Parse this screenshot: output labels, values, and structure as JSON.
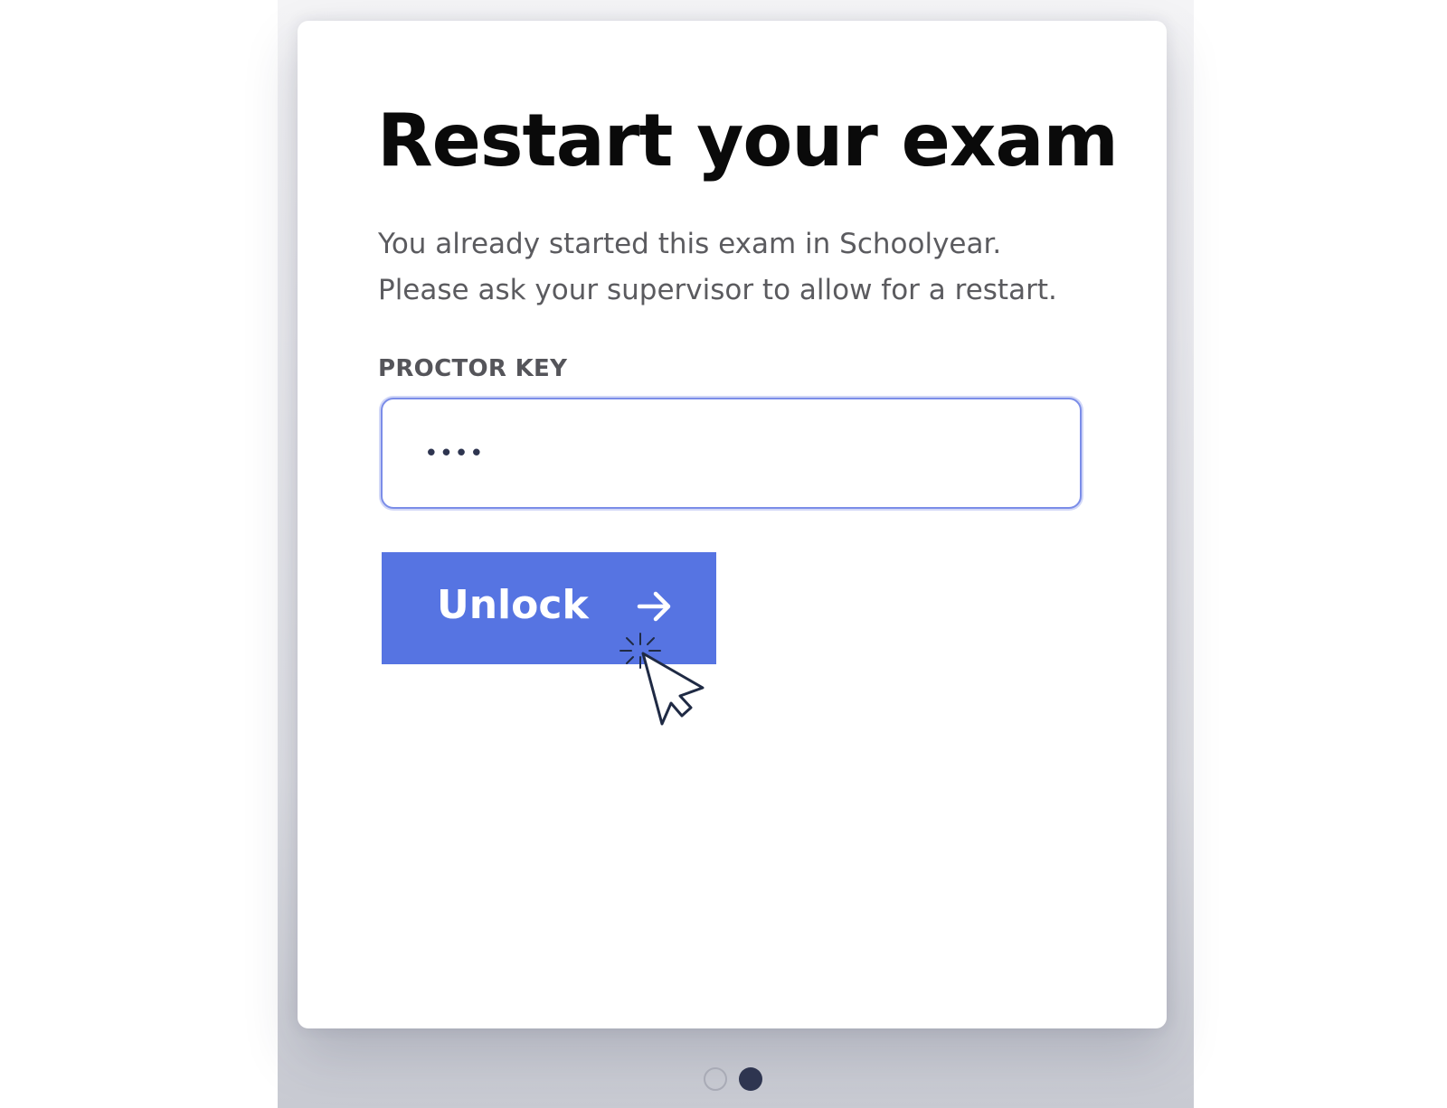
{
  "dialog": {
    "title": "Restart your exam",
    "description_line1": "You already started this exam in Schoolyear.",
    "description_line2": "Please ask your supervisor to allow for a restart.",
    "field_label": "PROCTOR KEY",
    "field_value": "••••",
    "button_label": "Unlock",
    "button_icon": "arrow-right-icon"
  },
  "pagination": {
    "total": 2,
    "current": 2
  },
  "colors": {
    "accent": "#5674e2",
    "input_focus_border": "#7b8de8",
    "title_text": "#0a0a0a",
    "body_text": "#5b5b5f",
    "pager_active": "#2e3550"
  }
}
